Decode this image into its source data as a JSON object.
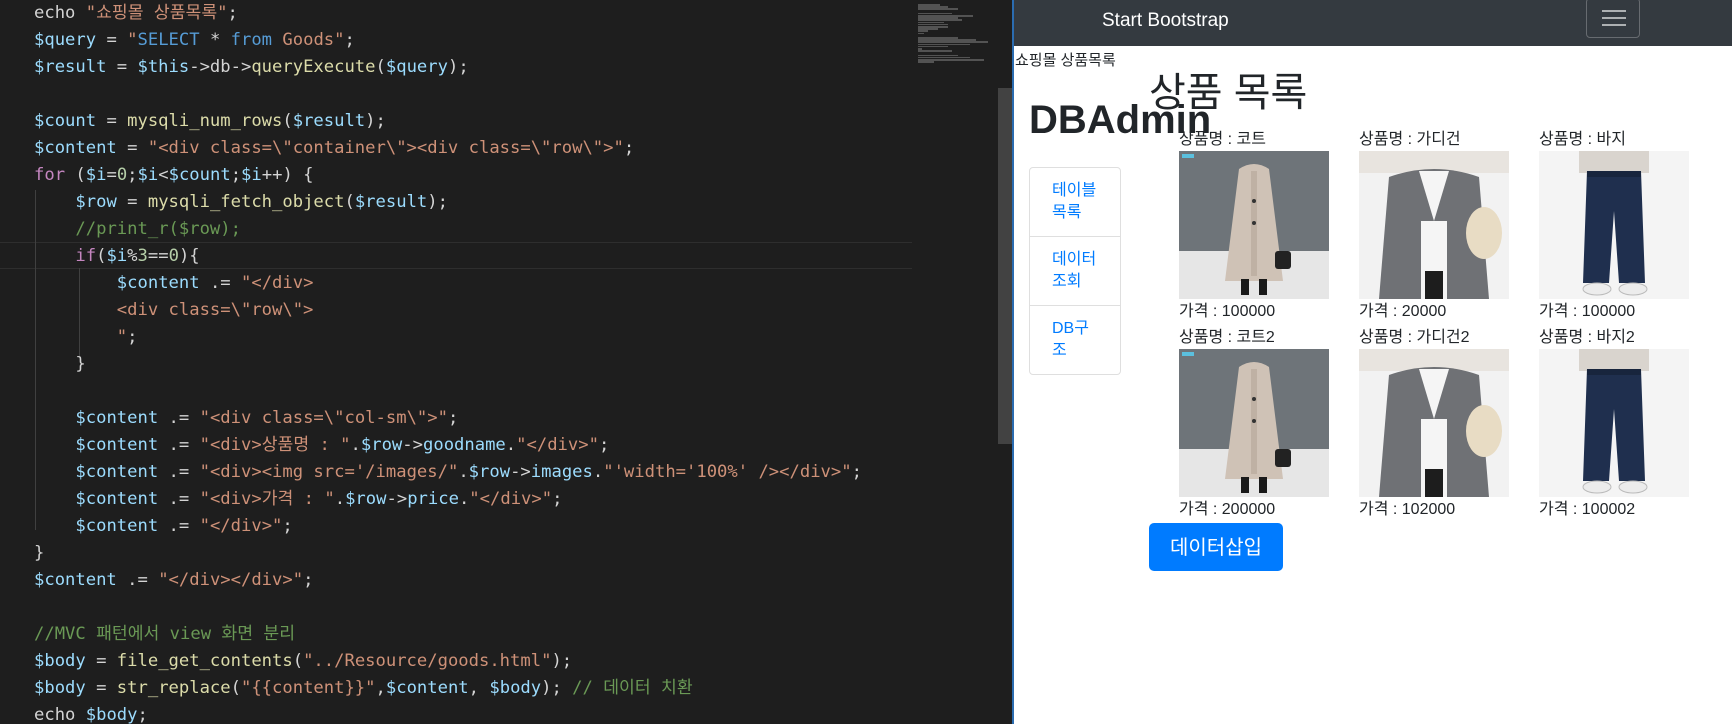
{
  "editor": {
    "lines": [
      [
        [
          "plain",
          "echo "
        ],
        [
          "str",
          "\"쇼핑몰 상품목록\""
        ],
        [
          "plain",
          ";"
        ]
      ],
      [
        [
          "var",
          "$query"
        ],
        [
          "plain",
          " = "
        ],
        [
          "str",
          "\""
        ],
        [
          "const",
          "SELECT"
        ],
        [
          "plain",
          " * "
        ],
        [
          "const",
          "from"
        ],
        [
          "str",
          " Goods\""
        ],
        [
          "plain",
          ";"
        ]
      ],
      [
        [
          "var",
          "$result"
        ],
        [
          "plain",
          " = "
        ],
        [
          "var",
          "$this"
        ],
        [
          "plain",
          "->db->"
        ],
        [
          "fn",
          "queryExecute"
        ],
        [
          "plain",
          "("
        ],
        [
          "var",
          "$query"
        ],
        [
          "plain",
          ");"
        ]
      ],
      [],
      [
        [
          "var",
          "$count"
        ],
        [
          "plain",
          " = "
        ],
        [
          "fn",
          "mysqli_num_rows"
        ],
        [
          "plain",
          "("
        ],
        [
          "var",
          "$result"
        ],
        [
          "plain",
          ");"
        ]
      ],
      [
        [
          "var",
          "$content"
        ],
        [
          "plain",
          " = "
        ],
        [
          "str",
          "\"<div class=\\\"container\\\"><div class=\\\"row\\\">\""
        ],
        [
          "plain",
          ";"
        ]
      ],
      [
        [
          "kw",
          "for"
        ],
        [
          "plain",
          " ("
        ],
        [
          "var",
          "$i"
        ],
        [
          "plain",
          "="
        ],
        [
          "num",
          "0"
        ],
        [
          "plain",
          ";"
        ],
        [
          "var",
          "$i"
        ],
        [
          "plain",
          "<"
        ],
        [
          "var",
          "$count"
        ],
        [
          "plain",
          ";"
        ],
        [
          "var",
          "$i"
        ],
        [
          "plain",
          "++) {"
        ]
      ],
      [
        [
          "plain",
          "    "
        ],
        [
          "var",
          "$row"
        ],
        [
          "plain",
          " = "
        ],
        [
          "fn",
          "mysqli_fetch_object"
        ],
        [
          "plain",
          "("
        ],
        [
          "var",
          "$result"
        ],
        [
          "plain",
          ");"
        ]
      ],
      [
        [
          "plain",
          "    "
        ],
        [
          "cmt",
          "//print_r($row);"
        ]
      ],
      [
        [
          "plain",
          "    "
        ],
        [
          "kw",
          "if"
        ],
        [
          "plain",
          "("
        ],
        [
          "var",
          "$i"
        ],
        [
          "plain",
          "%"
        ],
        [
          "num",
          "3"
        ],
        [
          "plain",
          "=="
        ],
        [
          "num",
          "0"
        ],
        [
          "plain",
          "){"
        ]
      ],
      [
        [
          "plain",
          "        "
        ],
        [
          "var",
          "$content"
        ],
        [
          "plain",
          " .= "
        ],
        [
          "str",
          "\"</div>"
        ]
      ],
      [
        [
          "plain",
          "        "
        ],
        [
          "str",
          "<div class=\\\"row\\\">"
        ]
      ],
      [
        [
          "plain",
          "        "
        ],
        [
          "str",
          "\""
        ],
        [
          "plain",
          ";"
        ]
      ],
      [
        [
          "plain",
          "    }"
        ]
      ],
      [],
      [
        [
          "plain",
          "    "
        ],
        [
          "var",
          "$content"
        ],
        [
          "plain",
          " .= "
        ],
        [
          "str",
          "\"<div class=\\\"col-sm\\\">\""
        ],
        [
          "plain",
          ";"
        ]
      ],
      [
        [
          "plain",
          "    "
        ],
        [
          "var",
          "$content"
        ],
        [
          "plain",
          " .= "
        ],
        [
          "str",
          "\"<div>상품명 : \""
        ],
        [
          "plain",
          "."
        ],
        [
          "var",
          "$row"
        ],
        [
          "plain",
          "->"
        ],
        [
          "var",
          "goodname"
        ],
        [
          "plain",
          "."
        ],
        [
          "str",
          "\"</div>\""
        ],
        [
          "plain",
          ";"
        ]
      ],
      [
        [
          "plain",
          "    "
        ],
        [
          "var",
          "$content"
        ],
        [
          "plain",
          " .= "
        ],
        [
          "str",
          "\"<div><img src='/images/\""
        ],
        [
          "plain",
          "."
        ],
        [
          "var",
          "$row"
        ],
        [
          "plain",
          "->"
        ],
        [
          "var",
          "images"
        ],
        [
          "plain",
          "."
        ],
        [
          "str",
          "\"'width='100%' /></div>\""
        ],
        [
          "plain",
          ";"
        ]
      ],
      [
        [
          "plain",
          "    "
        ],
        [
          "var",
          "$content"
        ],
        [
          "plain",
          " .= "
        ],
        [
          "str",
          "\"<div>가격 : \""
        ],
        [
          "plain",
          "."
        ],
        [
          "var",
          "$row"
        ],
        [
          "plain",
          "->"
        ],
        [
          "var",
          "price"
        ],
        [
          "plain",
          "."
        ],
        [
          "str",
          "\"</div>\""
        ],
        [
          "plain",
          ";"
        ]
      ],
      [
        [
          "plain",
          "    "
        ],
        [
          "var",
          "$content"
        ],
        [
          "plain",
          " .= "
        ],
        [
          "str",
          "\"</div>\""
        ],
        [
          "plain",
          ";"
        ]
      ],
      [
        [
          "plain",
          "}"
        ]
      ],
      [
        [
          "var",
          "$content"
        ],
        [
          "plain",
          " .= "
        ],
        [
          "str",
          "\"</div></div>\""
        ],
        [
          "plain",
          ";"
        ]
      ],
      [],
      [
        [
          "cmt",
          "//MVC 패턴에서 view 화면 분리"
        ]
      ],
      [
        [
          "var",
          "$body"
        ],
        [
          "plain",
          " = "
        ],
        [
          "fn",
          "file_get_contents"
        ],
        [
          "plain",
          "("
        ],
        [
          "str",
          "\"../Resource/goods.html\""
        ],
        [
          "plain",
          ");"
        ]
      ],
      [
        [
          "var",
          "$body"
        ],
        [
          "plain",
          " = "
        ],
        [
          "fn",
          "str_replace"
        ],
        [
          "plain",
          "("
        ],
        [
          "str",
          "\"{{content}}\""
        ],
        [
          "plain",
          ","
        ],
        [
          "var",
          "$content"
        ],
        [
          "plain",
          ", "
        ],
        [
          "var",
          "$body"
        ],
        [
          "plain",
          "); "
        ],
        [
          "cmt",
          "// 데이터 치환"
        ]
      ],
      [
        [
          "plain",
          "echo "
        ],
        [
          "var",
          "$body"
        ],
        [
          "plain",
          ";"
        ]
      ]
    ]
  },
  "preview": {
    "navbar": {
      "brand": "Start Bootstrap"
    },
    "echo_text": "쇼핑몰 상품목록",
    "brand_heading": "DBAdmin",
    "sidebar": [
      {
        "label": "테이블목록"
      },
      {
        "label": "데이터조회"
      },
      {
        "label": "DB구조"
      }
    ],
    "page_title": "상품 목록",
    "products": [
      {
        "name": "상품명 : 코트",
        "price": "가격 : 100000",
        "kind": "coat"
      },
      {
        "name": "상품명 : 가디건",
        "price": "가격 : 20000",
        "kind": "cardigan"
      },
      {
        "name": "상품명 : 바지",
        "price": "가격 : 100000",
        "kind": "pants"
      },
      {
        "name": "상품명 : 코트2",
        "price": "가격 : 200000",
        "kind": "coat"
      },
      {
        "name": "상품명 : 가디건2",
        "price": "가격 : 102000",
        "kind": "cardigan"
      },
      {
        "name": "상품명 : 바지2",
        "price": "가격 : 100002",
        "kind": "pants"
      }
    ],
    "insert_button": "데이터삽입"
  }
}
